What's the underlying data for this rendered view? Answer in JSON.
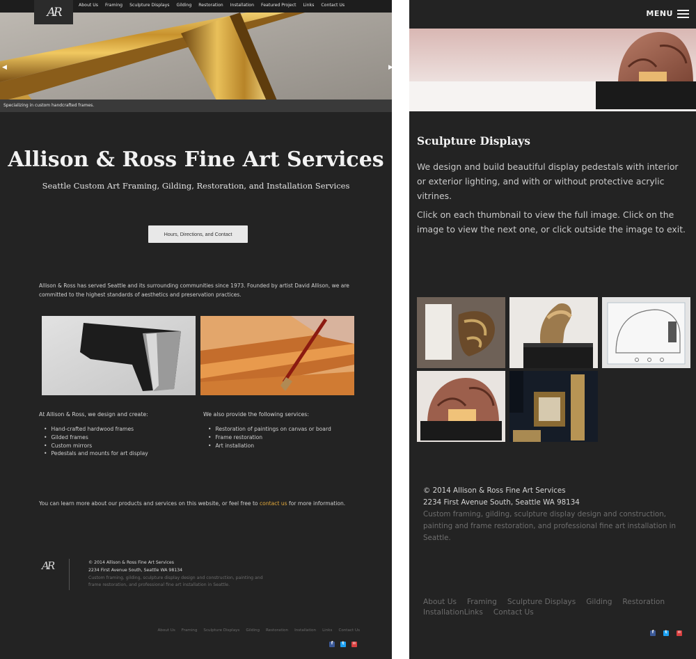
{
  "desktop": {
    "logo": "AR",
    "nav": [
      "About Us",
      "Framing",
      "Sculpture Displays",
      "Gilding",
      "Restoration",
      "Installation",
      "Featured Project",
      "Links",
      "Contact Us"
    ],
    "hero_caption": "Specializing in custom handcrafted frames.",
    "title": "Allison & Ross Fine Art Services",
    "subtitle": "Seattle Custom Art Framing, Gilding, Restoration, and Installation Services",
    "hours_button": "Hours, Directions, and Contact",
    "intro": "Allison & Ross has served Seattle and its surrounding communities since 1973. Founded by artist David Allison, we are committed to the highest standards of aesthetics and preservation practices.",
    "col1_title": "At Allison & Ross, we design and create:",
    "col1_items": [
      "Hand-crafted hardwood frames",
      "Gilded frames",
      "Custom mirrors",
      "Pedestals and mounts for art display"
    ],
    "col2_title": "We also provide the following services:",
    "col2_items": [
      "Restoration of paintings on canvas or board",
      "Frame restoration",
      "Art installation"
    ],
    "learn_more_before": "You can learn more about our products and services on this website, or feel free to ",
    "learn_more_link": "contact us",
    "learn_more_after": " for more information.",
    "footer_copyright": "© 2014 Allison & Ross Fine Art Services",
    "footer_address": "2234 First Avenue South, Seattle WA 98134",
    "footer_desc": "Custom framing, gilding, sculpture display design and construction, painting and frame restoration, and professional fine art installation in Seattle.",
    "footer_links": [
      "About Us",
      "Framing",
      "Sculpture Displays",
      "Gilding",
      "Restoration",
      "Installation",
      "Links",
      "Contact Us"
    ]
  },
  "mobile": {
    "menu_label": "MENU",
    "title": "Sculpture Displays",
    "para1": "We design and build beautiful display pedestals with interior or exterior lighting, and with or without protective acrylic vitrines.",
    "para2": "Click on each thumbnail to view the full image. Click on the image to view the next one, or click outside the image to exit.",
    "footer_copyright": "© 2014 Allison & Ross Fine Art Services",
    "footer_address": "2234 First Avenue South, Seattle WA 98134",
    "footer_desc": "Custom framing, gilding, sculpture display design and construction, painting and frame restoration, and professional fine art installation in Seattle.",
    "footer_links": [
      "About Us",
      "Framing",
      "Sculpture Displays",
      "Gilding",
      "Restoration",
      "Installation",
      "Links",
      "Contact Us"
    ]
  },
  "colors": {
    "background": "#232323",
    "link_accent": "#e3a93b",
    "facebook": "#3b5998",
    "twitter": "#1da1f2",
    "mail": "#d94040"
  },
  "icons": [
    "facebook-icon",
    "twitter-icon",
    "mail-icon",
    "menu-icon",
    "arrow-left-icon",
    "arrow-right-icon"
  ]
}
